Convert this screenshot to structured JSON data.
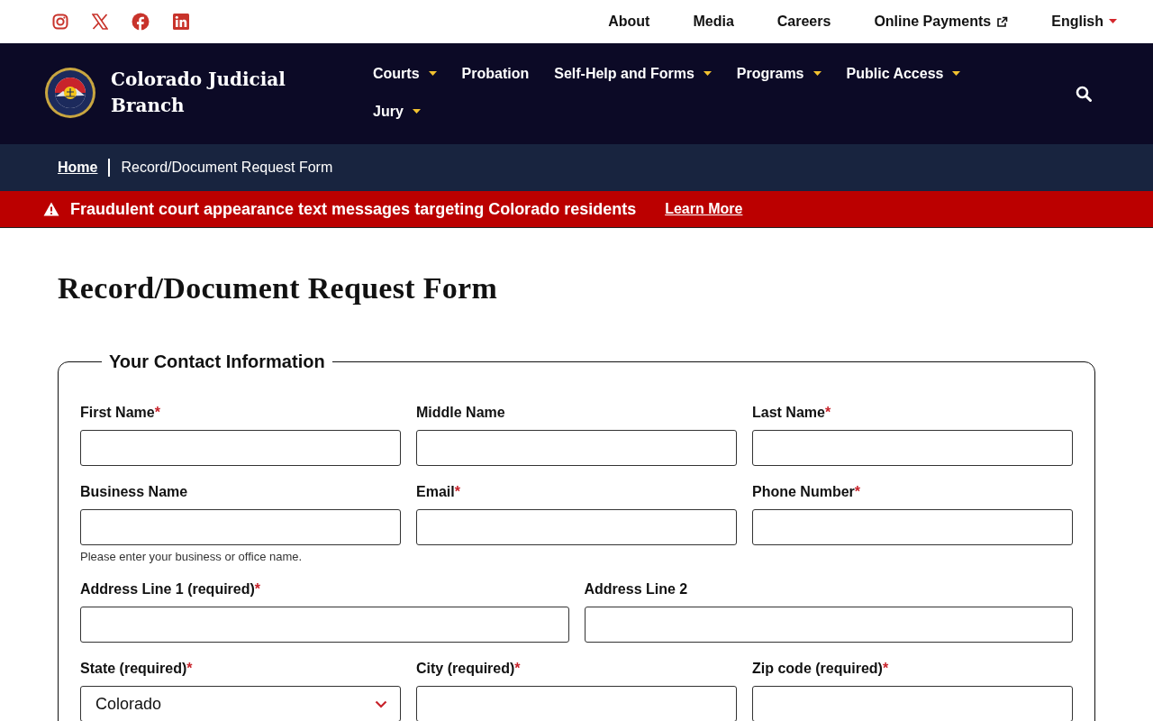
{
  "utility_nav": [
    {
      "label": "About",
      "external": false,
      "dropdown": false
    },
    {
      "label": "Media",
      "external": false,
      "dropdown": false
    },
    {
      "label": "Careers",
      "external": false,
      "dropdown": false
    },
    {
      "label": "Online Payments",
      "external": true,
      "dropdown": false
    },
    {
      "label": "English",
      "external": false,
      "dropdown": true
    }
  ],
  "brand": {
    "name": "Colorado Judicial Branch"
  },
  "main_nav": [
    {
      "label": "Courts",
      "dropdown": true
    },
    {
      "label": "Probation",
      "dropdown": false
    },
    {
      "label": "Self-Help and Forms",
      "dropdown": true
    },
    {
      "label": "Programs",
      "dropdown": true
    },
    {
      "label": "Public Access",
      "dropdown": true
    },
    {
      "label": "Jury",
      "dropdown": true
    }
  ],
  "breadcrumb": [
    {
      "label": "Home",
      "link": true
    },
    {
      "label": "Record/Document Request Form",
      "link": false
    }
  ],
  "alert": {
    "message": "Fraudulent court appearance text messages targeting Colorado residents",
    "link": "Learn More"
  },
  "page_title": "Record/Document Request Form",
  "form": {
    "legend": "Your Contact Information",
    "required_mark": "*",
    "rows": [
      [
        {
          "label": "First Name",
          "required": true,
          "kind": "text"
        },
        {
          "label": "Middle Name",
          "required": false,
          "kind": "text"
        },
        {
          "label": "Last Name",
          "required": true,
          "kind": "text"
        }
      ],
      [
        {
          "label": "Business Name",
          "required": false,
          "kind": "text",
          "help": "Please enter your business or office name."
        },
        {
          "label": "Email",
          "required": true,
          "kind": "text"
        },
        {
          "label": "Phone Number",
          "required": true,
          "kind": "text"
        }
      ],
      [
        {
          "label": "Address Line 1 (required)",
          "required": true,
          "kind": "text"
        },
        {
          "label": "Address Line 2",
          "required": false,
          "kind": "text"
        }
      ],
      [
        {
          "label": "State (required)",
          "required": true,
          "kind": "select",
          "value": "Colorado"
        },
        {
          "label": "City (required)",
          "required": true,
          "kind": "text"
        },
        {
          "label": "Zip code (required)",
          "required": true,
          "kind": "text"
        }
      ]
    ]
  }
}
